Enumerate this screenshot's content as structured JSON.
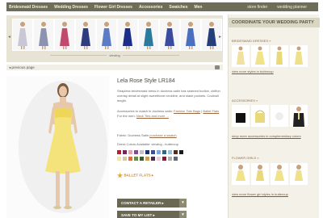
{
  "nav": {
    "left": [
      "Bridesmaid Dresses",
      "Wedding Dresses",
      "Flower Girl Dresses",
      "Accessories",
      "Swatches",
      "Men"
    ],
    "right": [
      "store finder",
      "wedding planner"
    ]
  },
  "strip": {
    "viewing": "viewing",
    "prev_arrow": "◂",
    "next_arrow": "▸",
    "thumb_colors": [
      "#c9c7d5",
      "#8c93b0",
      "#c14a6e",
      "#2f3d7e",
      "#5a7cc4",
      "#1c2d8a",
      "#2b7a9e",
      "#3a4a9e",
      "#4a6fc0",
      "#263f7a"
    ]
  },
  "prev": {
    "label": "◂ previous page"
  },
  "product": {
    "title": "Lela Rose Style LR184",
    "description": "Strapless bridesmaid dress in duchess satin has seamed bodice, chiffon overlay detail at slight sweetheart neckline, and slash pockets. Cocktail length.",
    "acc_intro": "Accessories to match in duchess satin:",
    "acc_link1": "Fashion Tote Bags",
    "acc_sep": "|",
    "acc_link2": "Ballet Flats",
    "men_intro": "For the men:",
    "men_link": "Neck Ties and more ...",
    "fabric_intro": "Fabric: Duchess Satin",
    "fabric_link": "purchase a swatch",
    "colors_text": "Dress Colors Available: viewing - buttercup",
    "ballet": "BALLET FLATS ▸",
    "btn_contact": "CONTACT A RETAILER ▸",
    "btn_add": "SAVE TO MY LIST ▸"
  },
  "swatch_colors": [
    "#b3212d",
    "#6b2a58",
    "#e9a1b6",
    "#7d4d8c",
    "#c6c0cc",
    "#1d2f6a",
    "#3b4f9e",
    "#7ea6d6",
    "#2a6a86",
    "#9bc0d6",
    "#5a2a1a",
    "#1a1a1a",
    "#f3e5a8",
    "#d1c6b0",
    "#e06a3a",
    "#6a8a4a",
    "#3a5a2a",
    "#c8a25a",
    "#4a2a4a",
    "#e8d0d8",
    "#8a1a2a",
    "#b0b0b0",
    "#5a6a7a"
  ],
  "side": {
    "head": "COORDINATE YOUR WEDDING PARTY",
    "sec1": "BRIDESMAID DRESSES »",
    "link1": "view more styles in buttercup",
    "sec2": "ACCESSORIES »",
    "link2": "shop more accessories in complementary colors",
    "sec3": "FLOWER GIRLS »",
    "link3": "view more flower girl styles in buttercup"
  }
}
